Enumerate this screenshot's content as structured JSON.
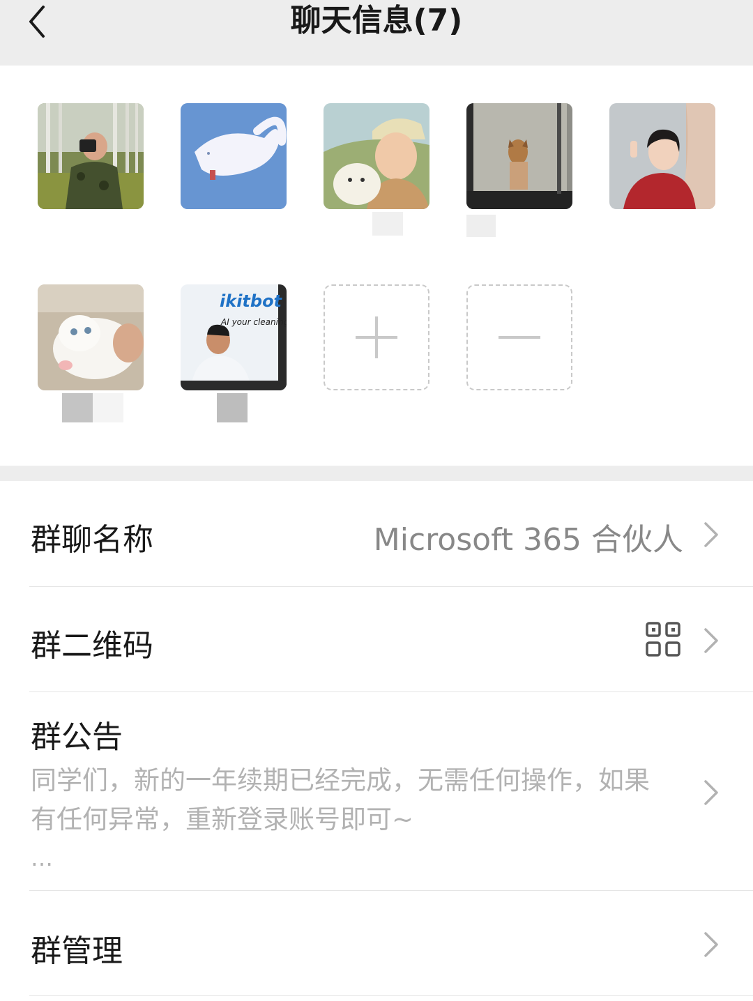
{
  "header": {
    "title": "聊天信息(7)",
    "back_icon": "chevron-left-icon"
  },
  "members": {
    "count": 7,
    "add_icon": "plus-icon",
    "remove_icon": "minus-icon"
  },
  "settings": {
    "group_name": {
      "label": "群聊名称",
      "value": "Microsoft 365 合伙人"
    },
    "qr_code": {
      "label": "群二维码",
      "icon": "qr-code-icon"
    },
    "announcement": {
      "label": "群公告",
      "text": "同学们，新的一年续期已经完成，无需任何操作，如果有任何异常，重新登录账号即可~",
      "more": "…"
    },
    "manage": {
      "label": "群管理"
    }
  },
  "colors": {
    "nav_bg": "#ededed",
    "text_primary": "#191919",
    "text_secondary": "#888888",
    "divider": "#e5e5e5"
  },
  "avatar_labels": {
    "a7_shirt_text": "ikitbot",
    "a7_tagline": "AI your cleaning"
  }
}
